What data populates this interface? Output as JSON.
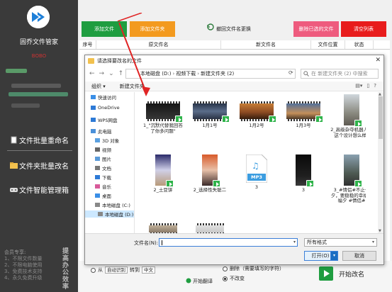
{
  "sidebar": {
    "app_title": "固乔文件管家",
    "user": "BOBO",
    "menu": [
      {
        "label": "文件批量重命名"
      },
      {
        "label": "文件夹批量改名"
      },
      {
        "label": "文件智能管理箱"
      }
    ],
    "member": {
      "title": "会员专享:",
      "benefits": [
        "1、不限文件数量",
        "2、不限电脑使用",
        "3、免费技术支持",
        "4、永久免费升级"
      ]
    },
    "vertical_text": "提高办公效率"
  },
  "toolbar": {
    "add_file": "添加文件",
    "add_folder": "添加文件夹",
    "restore": "撤回文件名更换",
    "delete_selected": "删除已选的文件",
    "clear_list": "清空列表",
    "colors": {
      "add_file": "#1f9d40",
      "add_folder": "#f39a1f",
      "delete_selected": "#ee5b7e",
      "clear_list": "#e81c1c"
    }
  },
  "list": {
    "columns": [
      "序号",
      "原文件名",
      "新文件名",
      "文件位置",
      "状态"
    ]
  },
  "bottom": {
    "from_label": "从",
    "mode_value": "自动识别",
    "to_label": "转到",
    "lang_value": "中文",
    "start_translate": "开始翻译",
    "delete_option": "删除（需要填写的字符）",
    "nochange_option": "不改变",
    "start_rename": "开始改名"
  },
  "dialog": {
    "title": "请选择要改名的文件",
    "breadcrumb": [
      "本地磁盘 (D:)",
      "视频下载",
      "新建文件夹 (2)"
    ],
    "search_placeholder": "在 新建文件夹 (2) 中搜索",
    "organize": "组织 ▾",
    "new_folder": "新建文件夹",
    "nav": [
      {
        "label": "快速访问",
        "icon": "star-icon"
      },
      {
        "label": "OneDrive",
        "icon": "cloud-icon"
      },
      {
        "label": "WPS网盘",
        "icon": "cloud-icon"
      },
      {
        "label": "此电脑",
        "icon": "computer-icon"
      },
      {
        "label": "3D 对象",
        "icon": "cube-icon"
      },
      {
        "label": "视频",
        "icon": "video-icon"
      },
      {
        "label": "图片",
        "icon": "picture-icon"
      },
      {
        "label": "文档",
        "icon": "document-icon"
      },
      {
        "label": "下载",
        "icon": "download-icon"
      },
      {
        "label": "音乐",
        "icon": "music-icon"
      },
      {
        "label": "桌面",
        "icon": "desktop-icon"
      },
      {
        "label": "本地磁盘 (C:)",
        "icon": "drive-icon"
      },
      {
        "label": "本地磁盘 (D:)",
        "icon": "drive-icon"
      }
    ],
    "files": [
      {
        "name": "1_\"沉默代替我回答了你多问题\"",
        "kind": "video"
      },
      {
        "name": "1月1号",
        "kind": "video"
      },
      {
        "name": "1月2号",
        "kind": "video"
      },
      {
        "name": "1月3号",
        "kind": "video"
      },
      {
        "name": "2_高级杂夺机器人，这个设计想么样?",
        "kind": "video"
      },
      {
        "name": "2_土豆饼",
        "kind": "video"
      },
      {
        "name": "2_选择性失聪二",
        "kind": "video"
      },
      {
        "name": "3",
        "kind": "audio",
        "badge": "MP3"
      },
      {
        "name": "3",
        "kind": "video"
      },
      {
        "name": "3_#情侣#不止七夕，要稳稳的幸福幸福夕 #情侣#",
        "kind": "video"
      },
      {
        "name": "",
        "kind": "video"
      },
      {
        "name": "",
        "kind": "video"
      }
    ],
    "filename_label": "文件名(N):",
    "filename_value": "",
    "filetype": "所有格式",
    "open": "打开(O)",
    "cancel": "取消"
  }
}
